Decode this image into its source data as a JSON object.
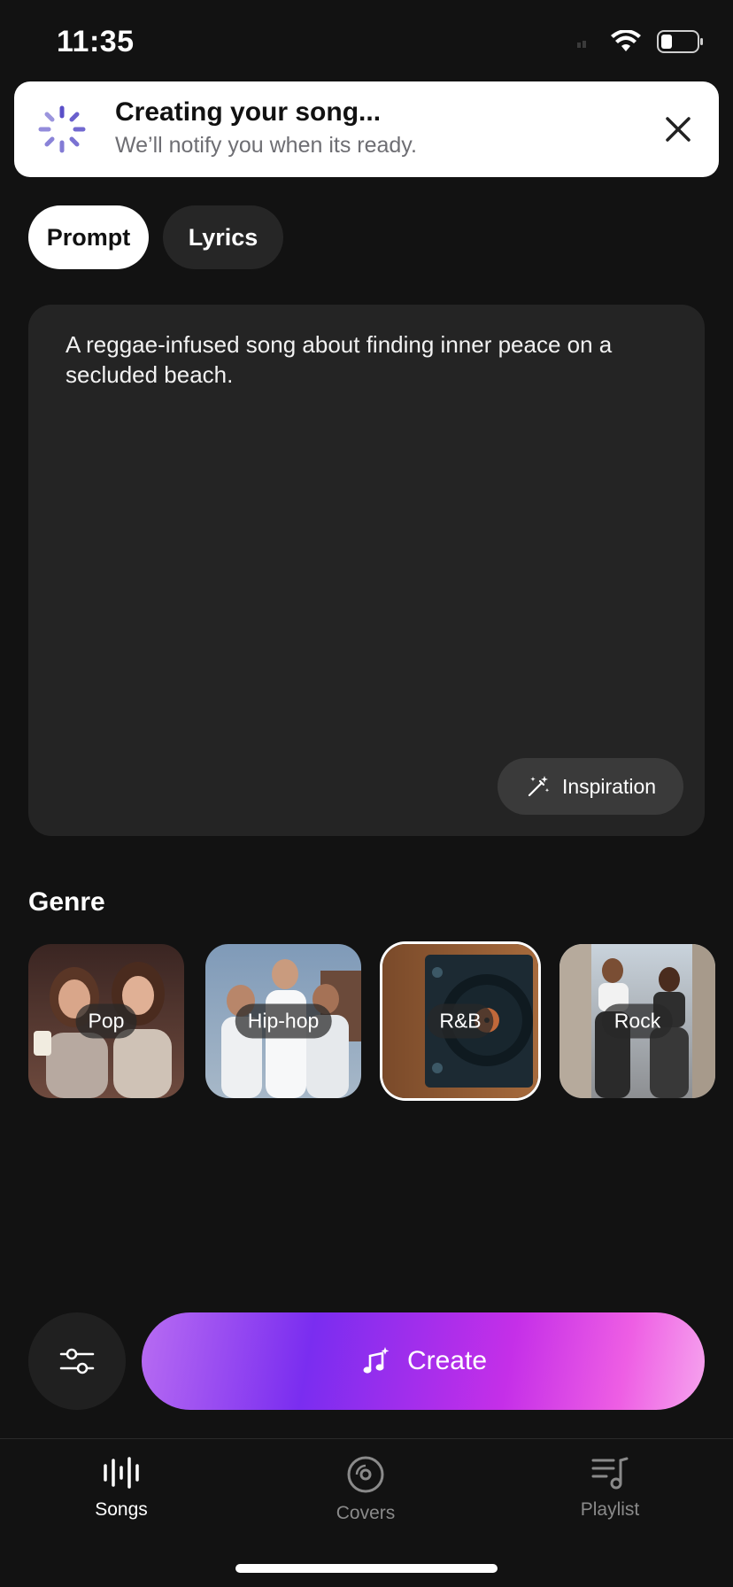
{
  "status_bar": {
    "time": "11:35"
  },
  "banner": {
    "title": "Creating your song...",
    "subtitle": "We’ll notify you when its ready."
  },
  "mode_tabs": {
    "prompt": "Prompt",
    "lyrics": "Lyrics",
    "selected": "Prompt"
  },
  "prompt": {
    "text": "A reggae-infused song about finding inner peace on a secluded beach.",
    "inspiration_label": "Inspiration"
  },
  "genre": {
    "heading": "Genre",
    "items": [
      {
        "label": "Pop",
        "selected": false
      },
      {
        "label": "Hip-hop",
        "selected": false
      },
      {
        "label": "R&B",
        "selected": true
      },
      {
        "label": "Rock",
        "selected": false
      }
    ]
  },
  "actions": {
    "create_label": "Create"
  },
  "tabbar": {
    "items": [
      {
        "label": "Songs",
        "icon": "waveform-icon",
        "active": true
      },
      {
        "label": "Covers",
        "icon": "disc-icon",
        "active": false
      },
      {
        "label": "Playlist",
        "icon": "playlist-icon",
        "active": false
      }
    ]
  },
  "colors": {
    "background": "#121212",
    "card": "#242424",
    "accent_purple": "#7a2df0",
    "accent_pink": "#ee5ee4",
    "spinner": "#5a4fc8"
  }
}
